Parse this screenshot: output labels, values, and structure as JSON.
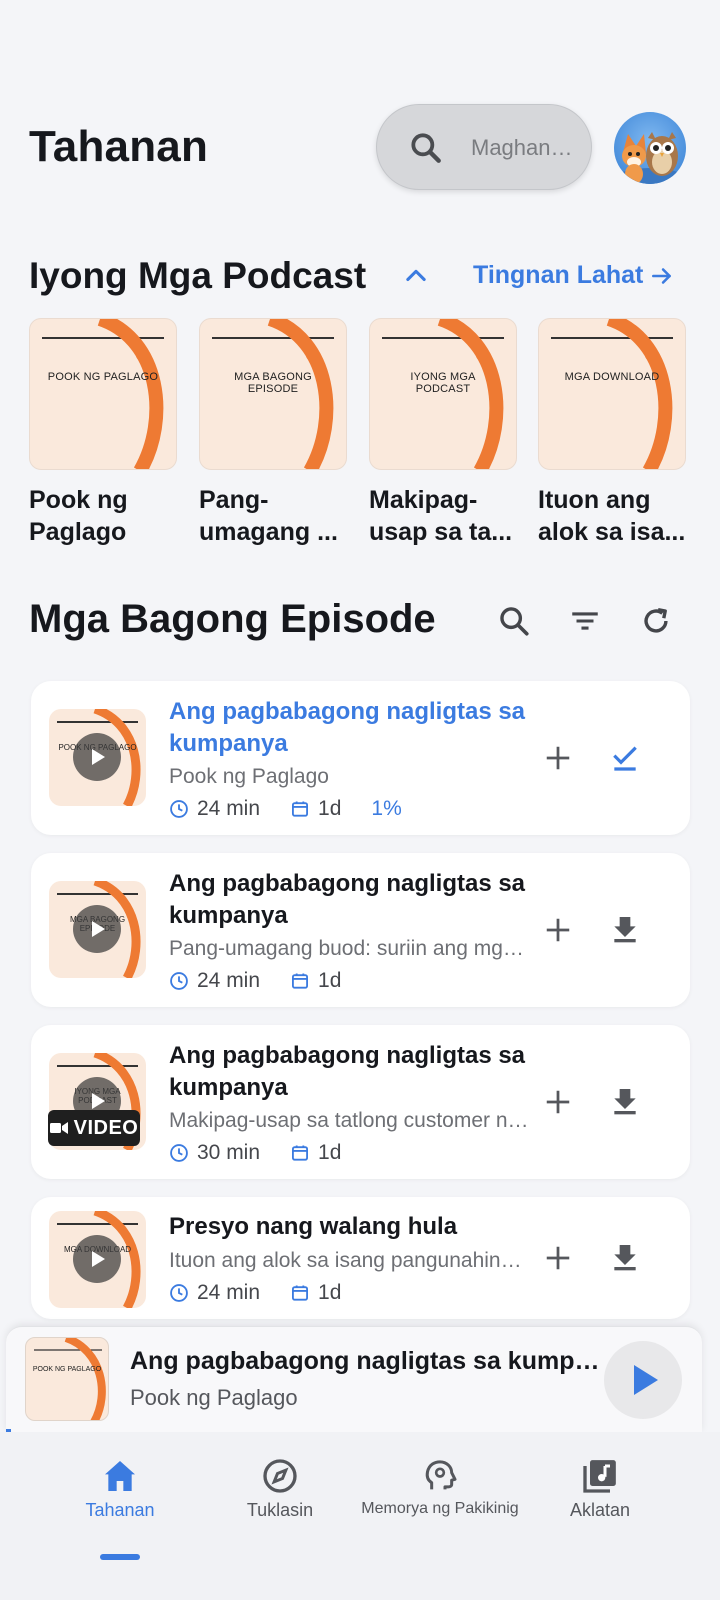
{
  "header": {
    "title": "Tahanan",
    "search_placeholder": "Maghanap..."
  },
  "podcasts_section": {
    "title": "Iyong Mga Podcast",
    "view_all": "Tingnan Lahat",
    "items": [
      {
        "cover_title": "POOK NG PAGLAGO",
        "name": "Pook ng Paglago"
      },
      {
        "cover_title": "MGA BAGONG EPISODE",
        "name": "Pang-umagang ..."
      },
      {
        "cover_title": "IYONG MGA PODCAST",
        "name": "Makipag-usap sa ta..."
      },
      {
        "cover_title": "MGA DOWNLOAD",
        "name": "Ituon ang alok sa isa..."
      }
    ]
  },
  "episodes_section": {
    "title": "Mga Bagong Episode",
    "video_badge": "VIDEO",
    "items": [
      {
        "thumb_title": "POOK NG PAGLAGO",
        "title": "Ang pagbabagong nagligtas sa kumpanya",
        "subtitle": "Pook ng Paglago",
        "duration": "24 min",
        "age": "1d",
        "progress": "1%",
        "action": "check-icon",
        "playing": true
      },
      {
        "thumb_title": "MGA BAGONG EPISODE",
        "title": "Ang pagbabagong nagligtas sa kumpanya",
        "subtitle": "Pang-umagang buod: suriin ang mga pangunahing balita",
        "duration": "24 min",
        "age": "1d",
        "progress": "",
        "action": "download-icon",
        "playing": false
      },
      {
        "thumb_title": "IYONG MGA PODCAST",
        "title": "Ang pagbabagong nagligtas sa kumpanya",
        "subtitle": "Makipag-usap sa tatlong customer ngayong linggo",
        "duration": "30 min",
        "age": "1d",
        "progress": "",
        "action": "download-icon",
        "playing": false
      },
      {
        "thumb_title": "MGA DOWNLOAD",
        "title": "Presyo nang walang hula",
        "subtitle": "Ituon ang alok sa isang pangunahing problema",
        "duration": "24 min",
        "age": "1d",
        "progress": "",
        "action": "download-icon",
        "playing": false
      }
    ]
  },
  "player": {
    "cover_title": "POOK NG PAGLAGO",
    "title": "Ang pagbabagong nagligtas sa kumpanya",
    "subtitle": "Pook ng Paglago"
  },
  "nav": {
    "items": [
      {
        "label": "Tahanan",
        "icon": "home-icon",
        "active": true
      },
      {
        "label": "Tuklasin",
        "icon": "compass-icon",
        "active": false
      },
      {
        "label": "Memorya ng Pakikinig",
        "icon": "memory-icon",
        "active": false
      },
      {
        "label": "Aklatan",
        "icon": "library-icon",
        "active": false
      }
    ]
  },
  "colors": {
    "accent": "#3b7be0",
    "cover_bg": "#fae9dc",
    "cover_arc": "#ee7a33"
  }
}
